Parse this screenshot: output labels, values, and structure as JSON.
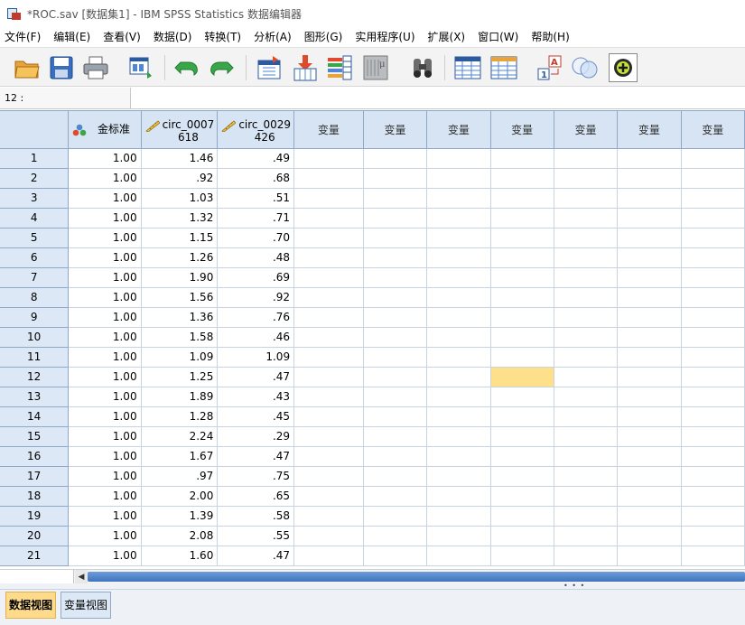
{
  "window": {
    "title": "*ROC.sav [数据集1] - IBM SPSS Statistics 数据编辑器"
  },
  "menu": [
    "文件(F)",
    "编辑(E)",
    "查看(V)",
    "数据(D)",
    "转换(T)",
    "分析(A)",
    "图形(G)",
    "实用程序(U)",
    "扩展(X)",
    "窗口(W)",
    "帮助(H)"
  ],
  "toolbar": {
    "icons": [
      "open-folder-icon",
      "save-icon",
      "print-icon",
      "dialog-recall-icon",
      "undo-icon",
      "redo-icon",
      "goto-case-icon",
      "goto-variable-icon",
      "variables-icon",
      "run-descriptives-icon",
      "find-icon",
      "insert-cases-icon",
      "insert-variable-icon",
      "split-file-icon",
      "select-cases-icon",
      "value-labels-icon",
      "use-sets-icon"
    ]
  },
  "cell_ref": {
    "label": "12 :",
    "value": ""
  },
  "grid": {
    "columns": [
      {
        "type": "nominal",
        "icon": "nominal-variable-icon",
        "line1": "金标准",
        "line2": ""
      },
      {
        "type": "scale",
        "icon": "scale-variable-icon",
        "line1": "circ_0007",
        "line2": "618"
      },
      {
        "type": "scale",
        "icon": "scale-variable-icon",
        "line1": "circ_0029",
        "line2": "426"
      },
      {
        "type": "empty",
        "line1": "变量"
      },
      {
        "type": "empty",
        "line1": "变量"
      },
      {
        "type": "empty",
        "line1": "变量"
      },
      {
        "type": "empty",
        "line1": "变量"
      },
      {
        "type": "empty",
        "line1": "变量"
      },
      {
        "type": "empty",
        "line1": "变量"
      },
      {
        "type": "empty",
        "line1": "变量"
      }
    ],
    "rows": [
      [
        "1",
        "1.00",
        "1.46",
        ".49"
      ],
      [
        "2",
        "1.00",
        ".92",
        ".68"
      ],
      [
        "3",
        "1.00",
        "1.03",
        ".51"
      ],
      [
        "4",
        "1.00",
        "1.32",
        ".71"
      ],
      [
        "5",
        "1.00",
        "1.15",
        ".70"
      ],
      [
        "6",
        "1.00",
        "1.26",
        ".48"
      ],
      [
        "7",
        "1.00",
        "1.90",
        ".69"
      ],
      [
        "8",
        "1.00",
        "1.56",
        ".92"
      ],
      [
        "9",
        "1.00",
        "1.36",
        ".76"
      ],
      [
        "10",
        "1.00",
        "1.58",
        ".46"
      ],
      [
        "11",
        "1.00",
        "1.09",
        "1.09"
      ],
      [
        "12",
        "1.00",
        "1.25",
        ".47"
      ],
      [
        "13",
        "1.00",
        "1.89",
        ".43"
      ],
      [
        "14",
        "1.00",
        "1.28",
        ".45"
      ],
      [
        "15",
        "1.00",
        "2.24",
        ".29"
      ],
      [
        "16",
        "1.00",
        "1.67",
        ".47"
      ],
      [
        "17",
        "1.00",
        ".97",
        ".75"
      ],
      [
        "18",
        "1.00",
        "2.00",
        ".65"
      ],
      [
        "19",
        "1.00",
        "1.39",
        ".58"
      ],
      [
        "20",
        "1.00",
        "2.08",
        ".55"
      ],
      [
        "21",
        "1.00",
        "1.60",
        ".47"
      ]
    ],
    "selected": {
      "row": 12,
      "col": 7
    }
  },
  "tabs": {
    "data_view": "数据视图",
    "variable_view": "变量视图",
    "active": "data_view"
  },
  "colors": {
    "header_bg": "#d6e4f4",
    "selected_cell": "#ffe08a",
    "active_tab": "#fddb8a",
    "scroll_thumb": "#3f74bf"
  }
}
